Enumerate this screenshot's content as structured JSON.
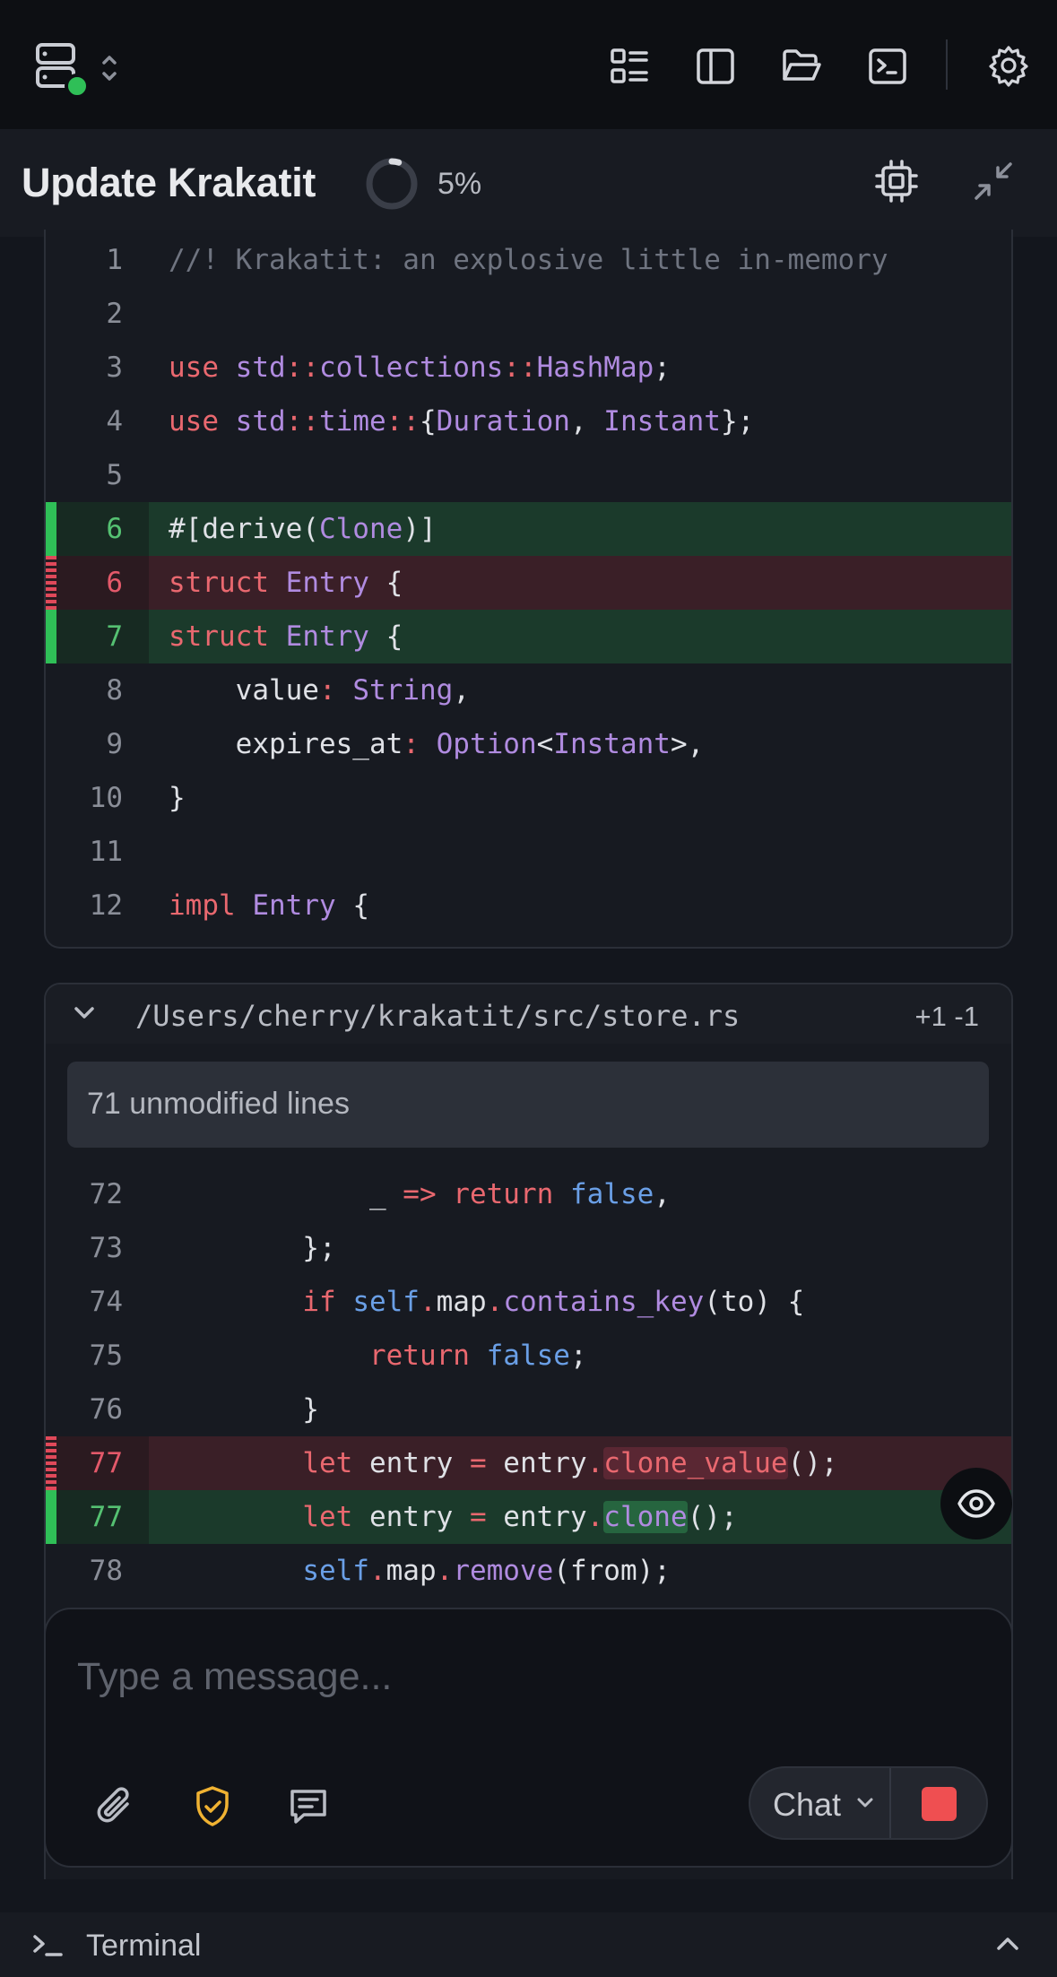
{
  "header": {
    "title": "Update Krakatit",
    "progress_text": "5%",
    "progress_value": 0.05
  },
  "diff_top": {
    "rows": [
      {
        "ln": "1",
        "kind": "ctx",
        "html": "<span class=\"c\">//! Krakatit: an explosive little in-memory</span>"
      },
      {
        "ln": "2",
        "kind": "ctx",
        "html": ""
      },
      {
        "ln": "3",
        "kind": "ctx",
        "html": "<span class=\"k\">use</span> <span class=\"t\">std</span><span class=\"k\">::</span><span class=\"t\">collections</span><span class=\"k\">::</span><span class=\"t\">HashMap</span>;"
      },
      {
        "ln": "4",
        "kind": "ctx",
        "html": "<span class=\"k\">use</span> <span class=\"t\">std</span><span class=\"k\">::</span><span class=\"t\">time</span><span class=\"k\">::</span>{<span class=\"t\">Duration</span>, <span class=\"t\">Instant</span>};"
      },
      {
        "ln": "5",
        "kind": "ctx",
        "html": ""
      },
      {
        "ln": "6",
        "kind": "add",
        "html": "#[derive(<span class=\"t\">Clone</span>)]"
      },
      {
        "ln": "6",
        "kind": "del",
        "html": "<span class=\"k\">struct</span> <span class=\"t\">Entry</span> {"
      },
      {
        "ln": "7",
        "kind": "add",
        "html": "<span class=\"k\">struct</span> <span class=\"t\">Entry</span> {"
      },
      {
        "ln": "8",
        "kind": "ctx",
        "html": "    value<span class=\"k\">:</span> <span class=\"t\">String</span>,"
      },
      {
        "ln": "9",
        "kind": "ctx",
        "html": "    expires_at<span class=\"k\">:</span> <span class=\"t\">Option</span>&lt;<span class=\"t\">Instant</span>&gt;,"
      },
      {
        "ln": "10",
        "kind": "ctx",
        "html": "}"
      },
      {
        "ln": "11",
        "kind": "ctx",
        "html": ""
      },
      {
        "ln": "12",
        "kind": "ctx",
        "html": "<span class=\"k\">impl</span> <span class=\"t\">Entry</span> {"
      }
    ]
  },
  "file2": {
    "path": "/Users/cherry/krakatit/src/store.rs",
    "stat": "+1 -1",
    "unmodified_label": "71 unmodified lines",
    "rows": [
      {
        "ln": "72",
        "kind": "ctx",
        "html": "            _ <span class=\"k\">=&gt;</span> <span class=\"k\">return</span> <span class=\"b\">false</span>,"
      },
      {
        "ln": "73",
        "kind": "ctx",
        "html": "        };"
      },
      {
        "ln": "74",
        "kind": "ctx",
        "html": "        <span class=\"k\">if</span> <span class=\"b\">self</span><span class=\"k\">.</span>map<span class=\"k\">.</span><span class=\"t\">contains_key</span>(to) {"
      },
      {
        "ln": "75",
        "kind": "ctx",
        "html": "            <span class=\"k\">return</span> <span class=\"b\">false</span>;"
      },
      {
        "ln": "76",
        "kind": "ctx",
        "html": "        }"
      },
      {
        "ln": "77",
        "kind": "del",
        "html": "        <span class=\"k\">let</span> entry <span class=\"k\">=</span> entry<span class=\"k\">.</span><span class=\"hlr\"><span class=\"k\">clone_value</span></span>();"
      },
      {
        "ln": "77",
        "kind": "add",
        "html": "        <span class=\"k\">let</span> entry <span class=\"k\">=</span> entry<span class=\"k\">.</span><span class=\"hlg\"><span class=\"t\">clone</span></span>();"
      },
      {
        "ln": "78",
        "kind": "ctx",
        "html": "        <span class=\"b\">self</span><span class=\"k\">.</span>map<span class=\"k\">.</span><span class=\"t\">remove</span>(from);"
      }
    ]
  },
  "composer": {
    "placeholder": "Type a message...",
    "mode_label": "Chat"
  },
  "footer": {
    "terminal_label": "Terminal"
  },
  "colors": {
    "status_dot": "#2fbf57",
    "shield_accent": "#f0b232",
    "stop": "#ef4f51"
  }
}
